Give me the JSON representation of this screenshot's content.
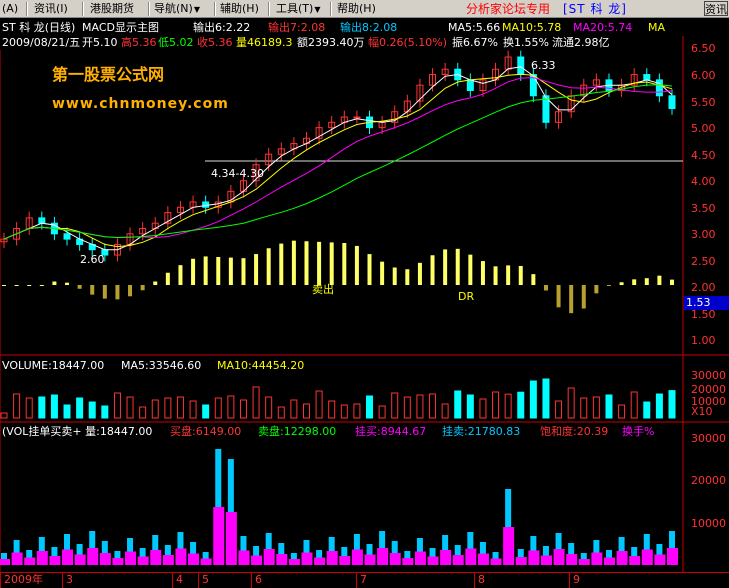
{
  "menu": {
    "items": [
      {
        "label": "(A)"
      },
      {
        "label": "资讯(I)"
      },
      {
        "label": "港股期货"
      },
      {
        "label": "导航(N)",
        "arrow": "▼"
      },
      {
        "label": "辅助(H)"
      },
      {
        "label": "工具(T)",
        "arrow": "▼"
      },
      {
        "label": "帮助(H)"
      }
    ],
    "forum_label": "分析家论坛专用",
    "stock_label": "[ST 科 龙]",
    "close_label": "资讯"
  },
  "main_chart": {
    "title": "ST 科 龙(日线)",
    "indicator": "MACD显示主图",
    "outputs": [
      {
        "label": "输出6:2.22",
        "color": "#ffffff"
      },
      {
        "label": "输出7:2.08",
        "color": "#ff3333"
      },
      {
        "label": "输出8:2.08",
        "color": "#00c8ff"
      },
      {
        "label": "MA5:5.66",
        "color": "#ffffff"
      },
      {
        "label": "MA10:5.78",
        "color": "#ffff00"
      },
      {
        "label": "MA20:5.74",
        "color": "#ff00ff"
      },
      {
        "label": "MA",
        "color": "#ffff00"
      }
    ],
    "quote": {
      "date": "2009/08/21/五",
      "open": "开5.10",
      "high": "高5.36",
      "low": "低5.02",
      "close": "收5.36",
      "volume": "量46189.3",
      "amount": "额2393.40万",
      "change": "幅0.26(5.10%)",
      "amplitude": "振6.67%",
      "turnover": "换1.55%",
      "float": "流通2.98亿"
    },
    "watermark_title": "第一股票公式网",
    "watermark_url": "www.chnmoney.com",
    "annotations": {
      "high_mark": "6.33",
      "range_mark": "4.34-4.30",
      "low_mark": "2.60",
      "tag1": "卖出",
      "tag2": "DR"
    },
    "y_ticks": [
      "6.50",
      "6.00",
      "5.50",
      "5.00",
      "4.50",
      "4.00",
      "3.50",
      "3.00",
      "2.50",
      "2.00",
      "1.50",
      "1.00"
    ],
    "current_value": "1.53"
  },
  "volume_panel": {
    "title": "VOLUME:18447.00",
    "ma5": "MA5:33546.60",
    "ma10": "MA10:44454.20",
    "y_ticks": [
      "30000",
      "20000",
      "10000"
    ],
    "unit": "X10"
  },
  "order_panel": {
    "title": "(VOL挂单买卖+ 量:18447.00",
    "buy": "买盘:6149.00",
    "sell": "卖盘:12298.00",
    "bid": "挂买:8944.67",
    "ask": "挂卖:21780.83",
    "saturation": "饱和度:20.39",
    "turnover": "换手%",
    "y_ticks": [
      "30000",
      "20000",
      "10000"
    ]
  },
  "x_axis": {
    "labels": [
      "2009年",
      "3",
      "4",
      "5",
      "6",
      "7",
      "8",
      "9"
    ]
  },
  "chart_data": {
    "type": "candlestick",
    "title": "ST 科 龙(日线)",
    "ylim": [
      0.9,
      6.7
    ],
    "price_points": [
      2.9,
      3.1,
      3.3,
      3.2,
      3.0,
      2.9,
      2.8,
      2.7,
      2.6,
      2.8,
      3.0,
      3.1,
      3.2,
      3.4,
      3.5,
      3.6,
      3.5,
      3.6,
      3.8,
      4.0,
      4.3,
      4.5,
      4.6,
      4.7,
      4.8,
      5.0,
      5.1,
      5.2,
      5.2,
      5.0,
      5.1,
      5.3,
      5.5,
      5.8,
      6.0,
      6.1,
      5.9,
      5.7,
      5.9,
      6.1,
      6.33,
      6.0,
      5.6,
      5.1,
      5.3,
      5.6,
      5.8,
      5.9,
      5.7,
      5.8,
      6.0,
      5.9,
      5.6,
      5.36
    ]
  }
}
